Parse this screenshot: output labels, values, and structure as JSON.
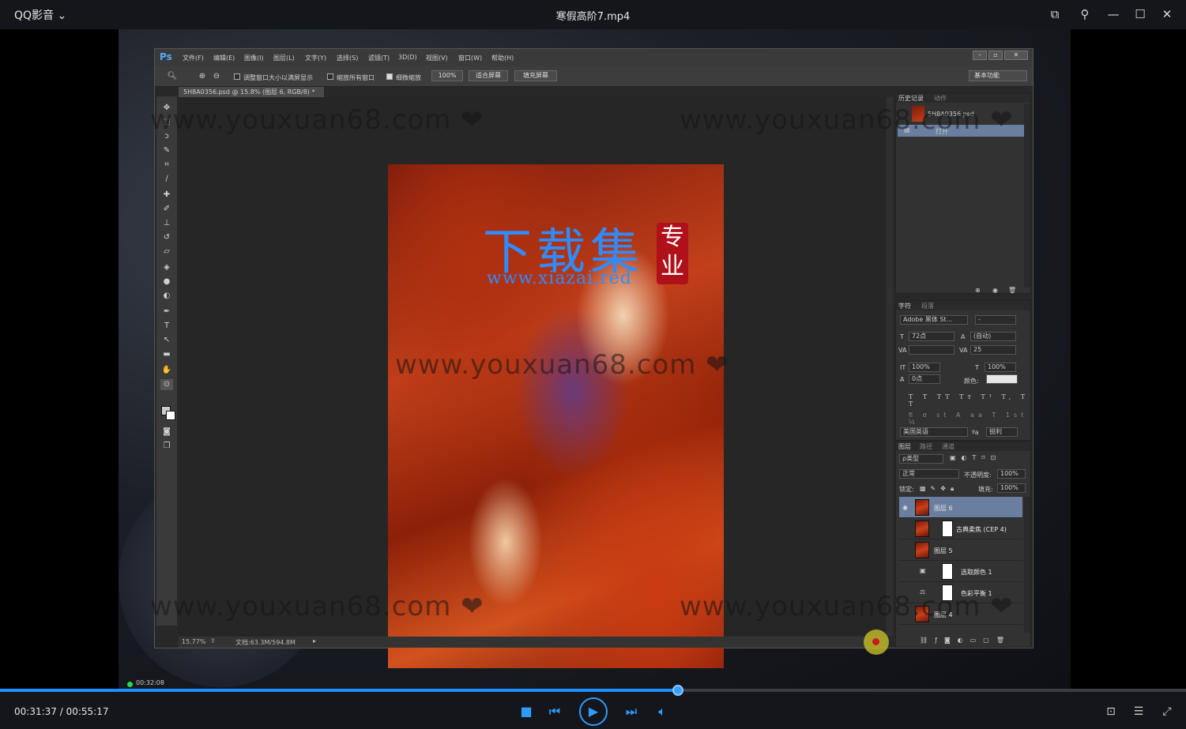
{
  "player": {
    "app_name": "QQ影音",
    "video_title": "寒假高阶7.mp4",
    "time_display": "00:31:37 / 00:55:17",
    "progress": 0.5718,
    "elapsed_badge": "00:32:08",
    "accent_color": "#1e90ff"
  },
  "ps": {
    "logo": "Ps",
    "menus": [
      "文件(F)",
      "编辑(E)",
      "图像(I)",
      "图层(L)",
      "文字(Y)",
      "选择(S)",
      "滤镜(T)",
      "3D(D)",
      "视图(V)",
      "窗口(W)",
      "帮助(H)"
    ],
    "options": {
      "resize_windows": "调整窗口大小以满屏显示",
      "zoom_all": "缩放所有窗口",
      "scrubby_zoom": "细微缩放",
      "zoom_value": "100%",
      "fit_screen": "适合屏幕",
      "fill_screen": "填充屏幕",
      "workspace": "基本功能"
    },
    "doc_tab": "5H8A0356.psd @ 15.8% (图层 6, RGB/8) *",
    "status_zoom": "15.77%",
    "status_doc": "文档:63.3M/594.8M",
    "watermark_title": "下载集",
    "watermark_seal": "专业",
    "watermark_url": "www.xiazai.red"
  },
  "history_panel": {
    "tabs": [
      "历史记录",
      "动作"
    ],
    "snapshot": "5H8A0356.psd",
    "items": [
      "打开"
    ]
  },
  "character_panel": {
    "tabs": [
      "字符",
      "段落"
    ],
    "font_family": "Adobe 黑体 St...",
    "font_style": "-",
    "font_size": "72点",
    "leading": "(自动)",
    "kerning": "",
    "tracking": "25",
    "vscale": "100%",
    "hscale": "100%",
    "baseline": "0点",
    "color_label": "颜色:",
    "language": "美国英语",
    "aa_label": "ªa",
    "antialias": "锐利"
  },
  "layers_panel": {
    "tabs": [
      "图层",
      "路径",
      "通道"
    ],
    "filter": "ρ类型",
    "blend_mode": "正常",
    "opacity_label": "不透明度:",
    "opacity": "100%",
    "lock_label": "锁定:",
    "fill_label": "填充:",
    "fill": "100%",
    "layers": [
      {
        "name": "图层 6",
        "selected": true,
        "mask": false,
        "adjustment": false
      },
      {
        "name": "古典柔焦 (CEP 4)",
        "selected": false,
        "mask": true,
        "adjustment": false
      },
      {
        "name": "图层 5",
        "selected": false,
        "mask": false,
        "adjustment": false
      },
      {
        "name": "选取颜色 1",
        "selected": false,
        "mask": true,
        "adjustment": true
      },
      {
        "name": "色彩平衡 1",
        "selected": false,
        "mask": true,
        "adjustment": true
      },
      {
        "name": "图层 4",
        "selected": false,
        "mask": false,
        "adjustment": false
      }
    ]
  },
  "watermark_text": "www.youxuan68.com ❤"
}
